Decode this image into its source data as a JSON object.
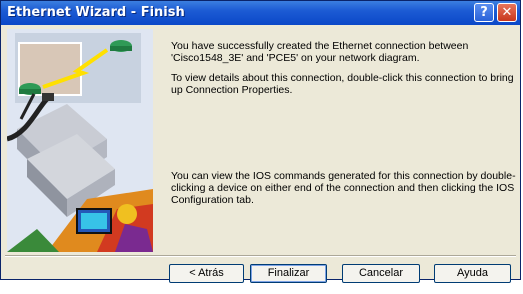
{
  "window": {
    "title": "Ethernet Wizard - Finish"
  },
  "titlebar": {
    "help_glyph": "?",
    "close_glyph": "✕"
  },
  "content": {
    "message1": "You have successfully created the Ethernet connection between 'Cisco1548_3E' and 'PCE5' on your network diagram.",
    "message2": "To view details about this connection, double-click this connection to bring up Connection Properties.",
    "message3": "You can view the IOS commands generated for this connection by double-clicking a device on either end of the connection  and then clicking the IOS Configuration tab."
  },
  "buttons": {
    "back": "< Atrás",
    "finish": "Finalizar",
    "cancel": "Cancelar",
    "help": "Ayuda"
  }
}
